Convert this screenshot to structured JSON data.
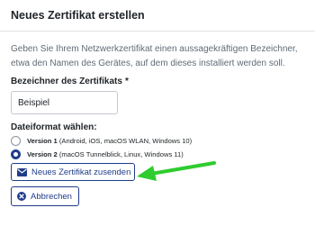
{
  "dialog": {
    "title": "Neues Zertifikat erstellen",
    "intro": "Geben Sie Ihrem Netzwerkzertifikat einen aussagekräftigen Bezeichner, etwa den Namen des Gerätes, auf dem dieses installiert werden soll."
  },
  "name_field": {
    "label": "Bezeichner des Zertifikats",
    "required_marker": "*",
    "value": "Beispiel"
  },
  "format": {
    "label": "Dateiformat wählen:",
    "options": [
      {
        "strong": "Version 1",
        "rest": " (Android, iOS, macOS WLAN, Windows 10)",
        "selected": false
      },
      {
        "strong": "Version 2",
        "rest": " (macOS Tunnelblick, Linux, Windows 11)",
        "selected": true
      }
    ]
  },
  "buttons": {
    "submit_label": "Neues Zertifikat zusenden",
    "cancel_label": "Abbrechen"
  },
  "icons": {
    "submit": "envelope-icon",
    "cancel": "close-circle-icon",
    "annotation": "green-arrow-icon"
  },
  "colors": {
    "primary": "#1f3d8a",
    "annotation_arrow": "#2ecc2e"
  }
}
